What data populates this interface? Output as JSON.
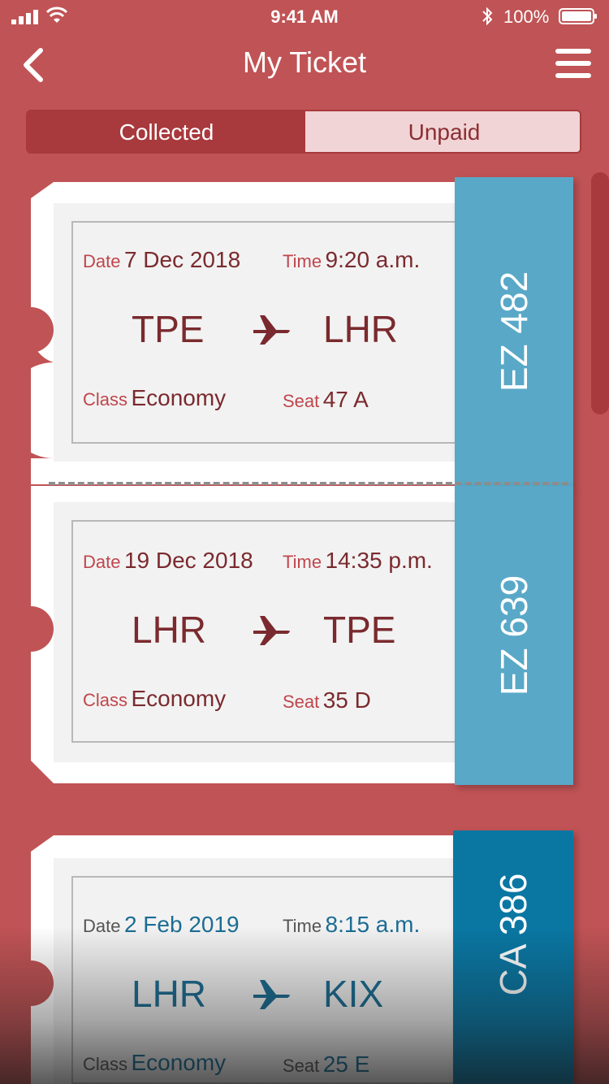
{
  "status_bar": {
    "time": "9:41 AM",
    "battery": "100%"
  },
  "nav": {
    "title": "My Ticket"
  },
  "tabs": [
    {
      "label": "Collected",
      "active": true
    },
    {
      "label": "Unpaid",
      "active": false
    }
  ],
  "tickets": [
    {
      "date_label": "Date",
      "date": "7 Dec 2018",
      "time_label": "Time",
      "time": "9:20 a.m.",
      "from": "TPE",
      "to": "LHR",
      "class_label": "Class",
      "class": "Economy",
      "seat_label": "Seat",
      "seat": "47 A",
      "flight": "EZ 482"
    },
    {
      "date_label": "Date",
      "date": "19 Dec 2018",
      "time_label": "Time",
      "time": "14:35 p.m.",
      "from": "LHR",
      "to": "TPE",
      "class_label": "Class",
      "class": "Economy",
      "seat_label": "Seat",
      "seat": "35 D",
      "flight": "EZ 639"
    },
    {
      "date_label": "Date",
      "date": "2 Feb 2019",
      "time_label": "Time",
      "time": "8:15 a.m.",
      "from": "LHR",
      "to": "KIX",
      "class_label": "Class",
      "class": "Economy",
      "seat_label": "Seat",
      "seat": "25 E",
      "flight": "CA 386"
    }
  ],
  "colors": {
    "background": "#c05355",
    "accent_dark": "#a8393d",
    "ticket_red_text": "#7a2a2e",
    "ticket_red_label": "#c0464c",
    "flag_blue": "#59a8c8",
    "flag_dark_blue": "#0a77a3",
    "ticket_blue_text": "#1b6d93"
  }
}
